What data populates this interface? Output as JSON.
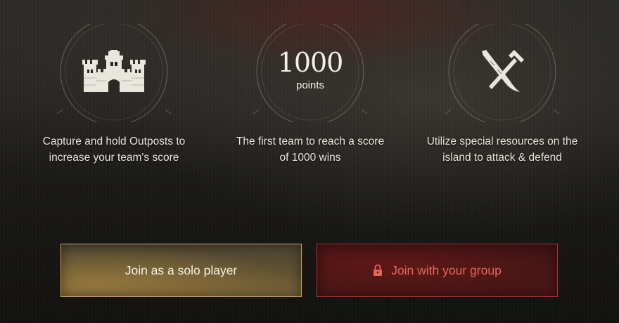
{
  "features": [
    {
      "icon": "castle-icon",
      "description_line1": "Capture and hold Outposts to",
      "description_line2": "increase your team's score"
    },
    {
      "score_value": "1000",
      "score_unit": "points",
      "description_line1": "The first team to reach a score",
      "description_line2": "of 1000 wins"
    },
    {
      "icon": "crossed-tools-icon",
      "description_line1": "Utilize special resources on the",
      "description_line2": "island to attack & defend"
    }
  ],
  "buttons": {
    "solo_label": "Join as a solo player",
    "group_label": "Join with your group",
    "group_icon": "lock-icon"
  },
  "colors": {
    "solo_border": "#c9a455",
    "group_border": "#b43630",
    "group_text": "#e5685e",
    "text": "#ebe7de"
  }
}
